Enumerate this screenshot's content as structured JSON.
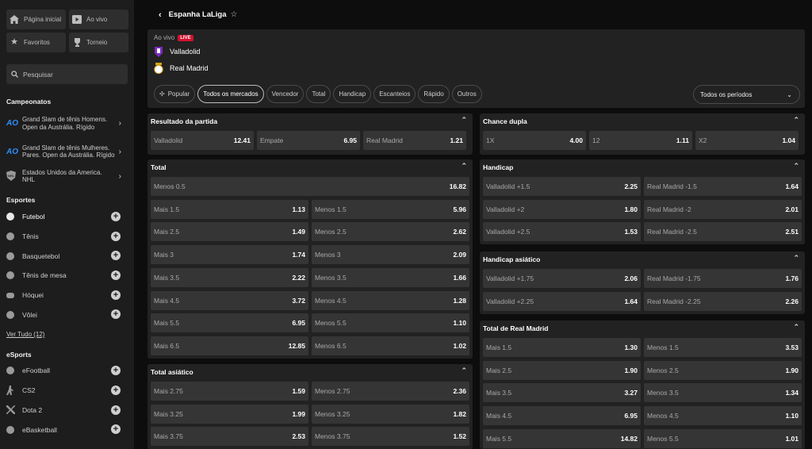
{
  "sidebar": {
    "quick": [
      {
        "label": "Página inicial",
        "icon": "home-icon"
      },
      {
        "label": "Ao vivo",
        "icon": "play-icon"
      },
      {
        "label": "Favoritos",
        "icon": "star-icon"
      },
      {
        "label": "Torneio",
        "icon": "trophy-icon"
      }
    ],
    "search_label": "Pesquisar",
    "championships_heading": "Campeonatos",
    "championships": [
      {
        "label": "Grand Slam de tênis Homens. Open da Austrália. Rígido",
        "icon": "australian-open-icon"
      },
      {
        "label": "Grand Slam de tênis Mulheres. Pares. Open da Austrália. Rígido",
        "icon": "australian-open-icon"
      },
      {
        "label": "Estados Unidos da America. NHL",
        "icon": "nhl-icon"
      }
    ],
    "sports_heading": "Esportes",
    "sports": [
      {
        "label": "Futebol",
        "icon": "soccer-ball-icon"
      },
      {
        "label": "Tênis",
        "icon": "tennis-ball-icon"
      },
      {
        "label": "Basquetebol",
        "icon": "basketball-icon"
      },
      {
        "label": "Tênis de mesa",
        "icon": "table-tennis-icon"
      },
      {
        "label": "Hóquei",
        "icon": "hockey-puck-icon"
      },
      {
        "label": "Vôlei",
        "icon": "volleyball-icon"
      }
    ],
    "see_all": "Ver Tudo (12)",
    "esports_heading": "eSports",
    "esports": [
      {
        "label": "eFootball",
        "icon": "efootball-icon"
      },
      {
        "label": "CS2",
        "icon": "cs2-icon"
      },
      {
        "label": "Dota 2",
        "icon": "dota2-icon"
      },
      {
        "label": "eBasketball",
        "icon": "ebasketball-icon"
      }
    ]
  },
  "header": {
    "title": "Espanha LaLiga"
  },
  "match": {
    "live_label": "Ao vivo",
    "live_badge": "LIVE",
    "home": "Valladolid",
    "away": "Real Madrid"
  },
  "filters": [
    "Popular",
    "Todos os mercados",
    "Vencedor",
    "Total",
    "Handicap",
    "Escanteios",
    "Rápido",
    "Outros"
  ],
  "active_filter": "Todos os mercados",
  "period_label": "Todos os períodos",
  "markets": {
    "result": {
      "title": "Resultado da partida",
      "odds": [
        [
          "Valladolid",
          "12.41"
        ],
        [
          "Empate",
          "6.95"
        ],
        [
          "Real Madrid",
          "1.21"
        ]
      ]
    },
    "double": {
      "title": "Chance dupla",
      "odds": [
        [
          "1X",
          "4.00"
        ],
        [
          "12",
          "1.11"
        ],
        [
          "X2",
          "1.04"
        ]
      ]
    },
    "total": {
      "title": "Total",
      "first": [
        "Menos 0.5",
        "16.82"
      ],
      "rows": [
        [
          [
            "Mais 1.5",
            "1.13"
          ],
          [
            "Menos 1.5",
            "5.96"
          ]
        ],
        [
          [
            "Mais 2.5",
            "1.49"
          ],
          [
            "Menos 2.5",
            "2.62"
          ]
        ],
        [
          [
            "Mais 3",
            "1.74"
          ],
          [
            "Menos 3",
            "2.09"
          ]
        ],
        [
          [
            "Mais 3.5",
            "2.22"
          ],
          [
            "Menos 3.5",
            "1.66"
          ]
        ],
        [
          [
            "Mais 4.5",
            "3.72"
          ],
          [
            "Menos 4.5",
            "1.28"
          ]
        ],
        [
          [
            "Mais 5.5",
            "6.95"
          ],
          [
            "Menos 5.5",
            "1.10"
          ]
        ],
        [
          [
            "Mais 6.5",
            "12.85"
          ],
          [
            "Menos 6.5",
            "1.02"
          ]
        ]
      ]
    },
    "asian_total": {
      "title": "Total asiático",
      "rows": [
        [
          [
            "Mais 2.75",
            "1.59"
          ],
          [
            "Menos 2.75",
            "2.36"
          ]
        ],
        [
          [
            "Mais 3.25",
            "1.99"
          ],
          [
            "Menos 3.25",
            "1.82"
          ]
        ],
        [
          [
            "Mais 3.75",
            "2.53"
          ],
          [
            "Menos 3.75",
            "1.52"
          ]
        ]
      ]
    },
    "handicap": {
      "title": "Handicap",
      "rows": [
        [
          [
            "Valladolid +1.5",
            "2.25"
          ],
          [
            "Real Madrid -1.5",
            "1.64"
          ]
        ],
        [
          [
            "Valladolid +2",
            "1.80"
          ],
          [
            "Real Madrid -2",
            "2.01"
          ]
        ],
        [
          [
            "Valladolid +2.5",
            "1.53"
          ],
          [
            "Real Madrid -2.5",
            "2.51"
          ]
        ]
      ]
    },
    "asian_handicap": {
      "title": "Handicap asiático",
      "rows": [
        [
          [
            "Valladolid +1.75",
            "2.06"
          ],
          [
            "Real Madrid -1.75",
            "1.76"
          ]
        ],
        [
          [
            "Valladolid +2.25",
            "1.64"
          ],
          [
            "Real Madrid -2.25",
            "2.26"
          ]
        ]
      ]
    },
    "team_total": {
      "title": "Total de Real Madrid",
      "rows": [
        [
          [
            "Mais 1.5",
            "1.30"
          ],
          [
            "Menos 1.5",
            "3.53"
          ]
        ],
        [
          [
            "Mais 2.5",
            "1.90"
          ],
          [
            "Menos 2.5",
            "1.90"
          ]
        ],
        [
          [
            "Mais 3.5",
            "3.27"
          ],
          [
            "Menos 3.5",
            "1.34"
          ]
        ],
        [
          [
            "Mais 4.5",
            "6.95"
          ],
          [
            "Menos 4.5",
            "1.10"
          ]
        ],
        [
          [
            "Mais 5.5",
            "14.82"
          ],
          [
            "Menos 5.5",
            "1.01"
          ]
        ]
      ]
    }
  }
}
